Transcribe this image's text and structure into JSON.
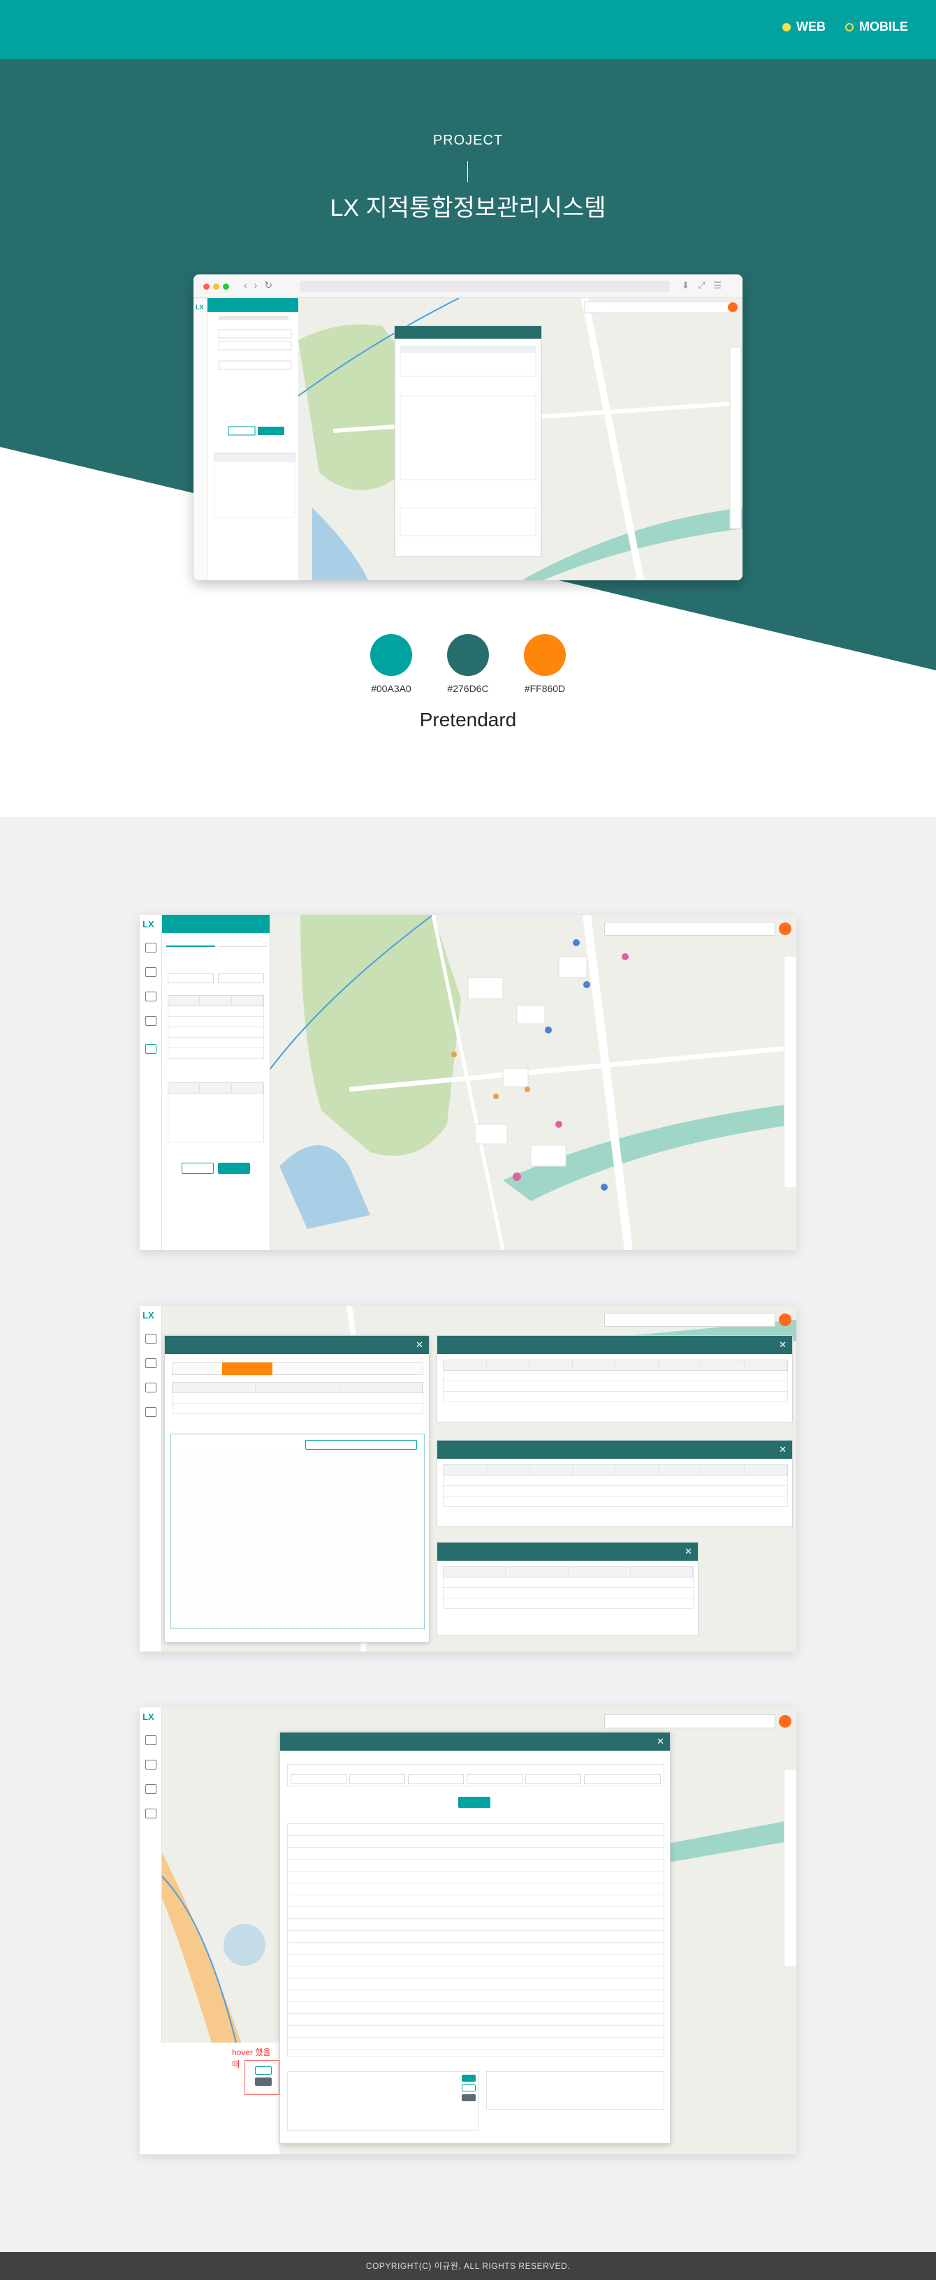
{
  "nav": {
    "web": "WEB",
    "mobile": "MOBILE"
  },
  "hero": {
    "label": "PROJECT",
    "title": "LX 지적통합정보관리시스템"
  },
  "palette": [
    {
      "hex": "#00A3A0",
      "label": "#00A3A0"
    },
    {
      "hex": "#276D6C",
      "label": "#276D6C"
    },
    {
      "hex": "#FF860D",
      "label": "#FF860D"
    }
  ],
  "font_name": "Pretendard",
  "screens": {
    "hover_note": "hover 했을 때"
  },
  "footer": {
    "copyright": "COPYRIGHT(C) 이규원, ALL RIGHTS RESERVED."
  },
  "colors": {
    "teal": "#00a3a0",
    "dark_teal": "#276d6c",
    "orange": "#ff860d",
    "map_land": "#eeefe9",
    "park": "#c9dfb4",
    "water": "#a9cfe6",
    "road_major": "#f7c98a",
    "river": "#9fd6c8"
  },
  "icons": [
    "home-icon",
    "search-icon",
    "layer-icon",
    "measure-icon",
    "print-icon",
    "close-icon",
    "zoom-in-icon",
    "zoom-out-icon",
    "user-icon"
  ]
}
